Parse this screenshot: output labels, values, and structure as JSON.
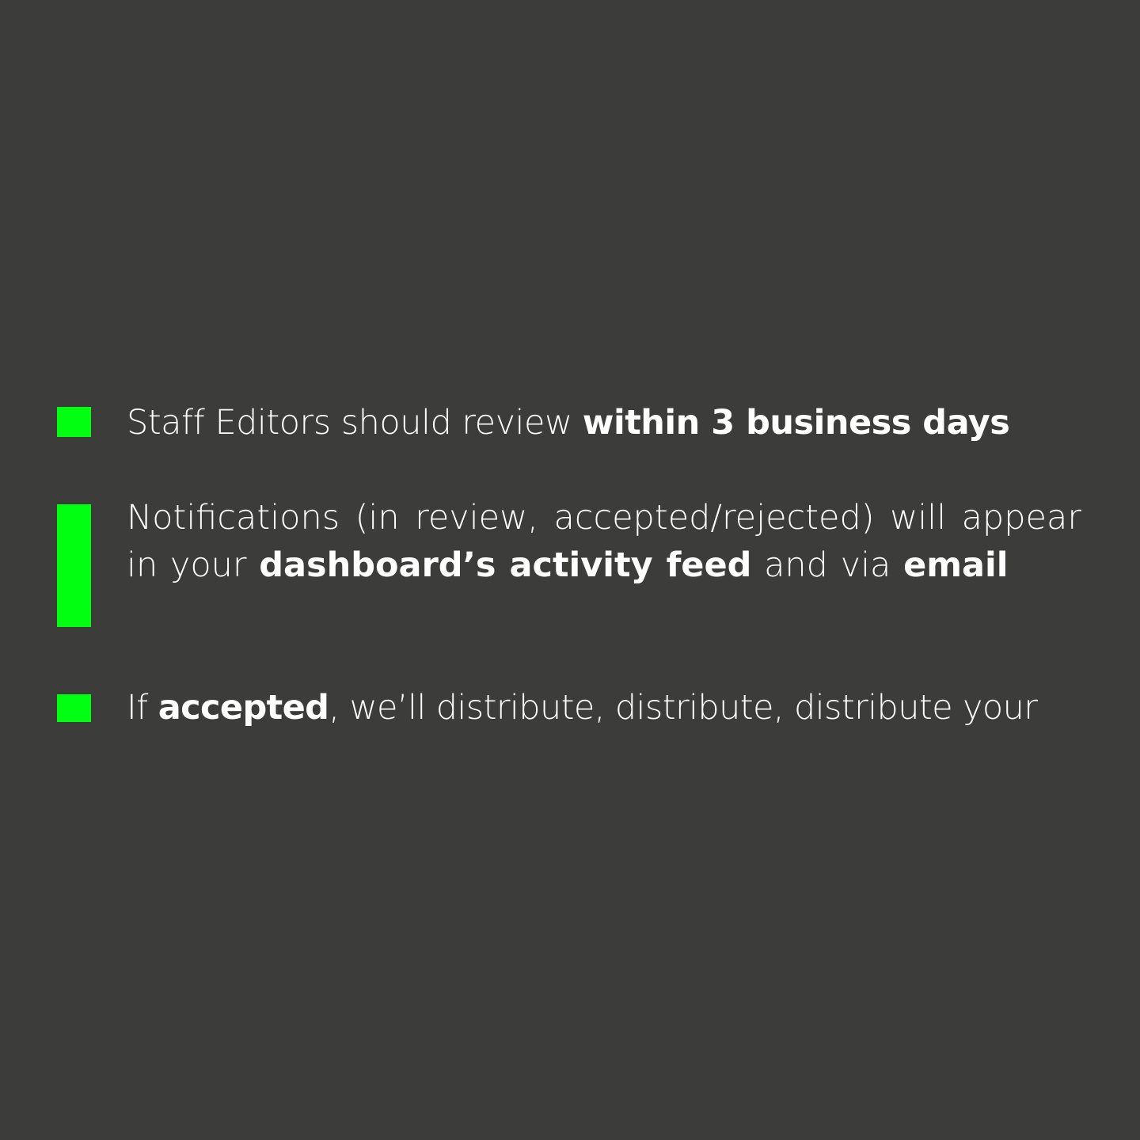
{
  "colors": {
    "background": "#3c3c3a",
    "marker": "#00ff11",
    "text": "#ffffff"
  },
  "items": [
    {
      "parts": [
        {
          "text": "Staff Editors should review ",
          "bold": false
        },
        {
          "text": "within 3 business days",
          "bold": true
        }
      ]
    },
    {
      "parts": [
        {
          "text": "Notifications (in review, accepted/rejected) will appear in your ",
          "bold": false
        },
        {
          "text": "dashboard’s activity feed",
          "bold": true
        },
        {
          "text": " and via ",
          "bold": false
        },
        {
          "text": "email",
          "bold": true
        }
      ]
    },
    {
      "parts": [
        {
          "text": "If ",
          "bold": false
        },
        {
          "text": "accepted",
          "bold": true
        },
        {
          "text": ", we’ll distribute, distribute, distribute your",
          "bold": false
        }
      ]
    }
  ]
}
